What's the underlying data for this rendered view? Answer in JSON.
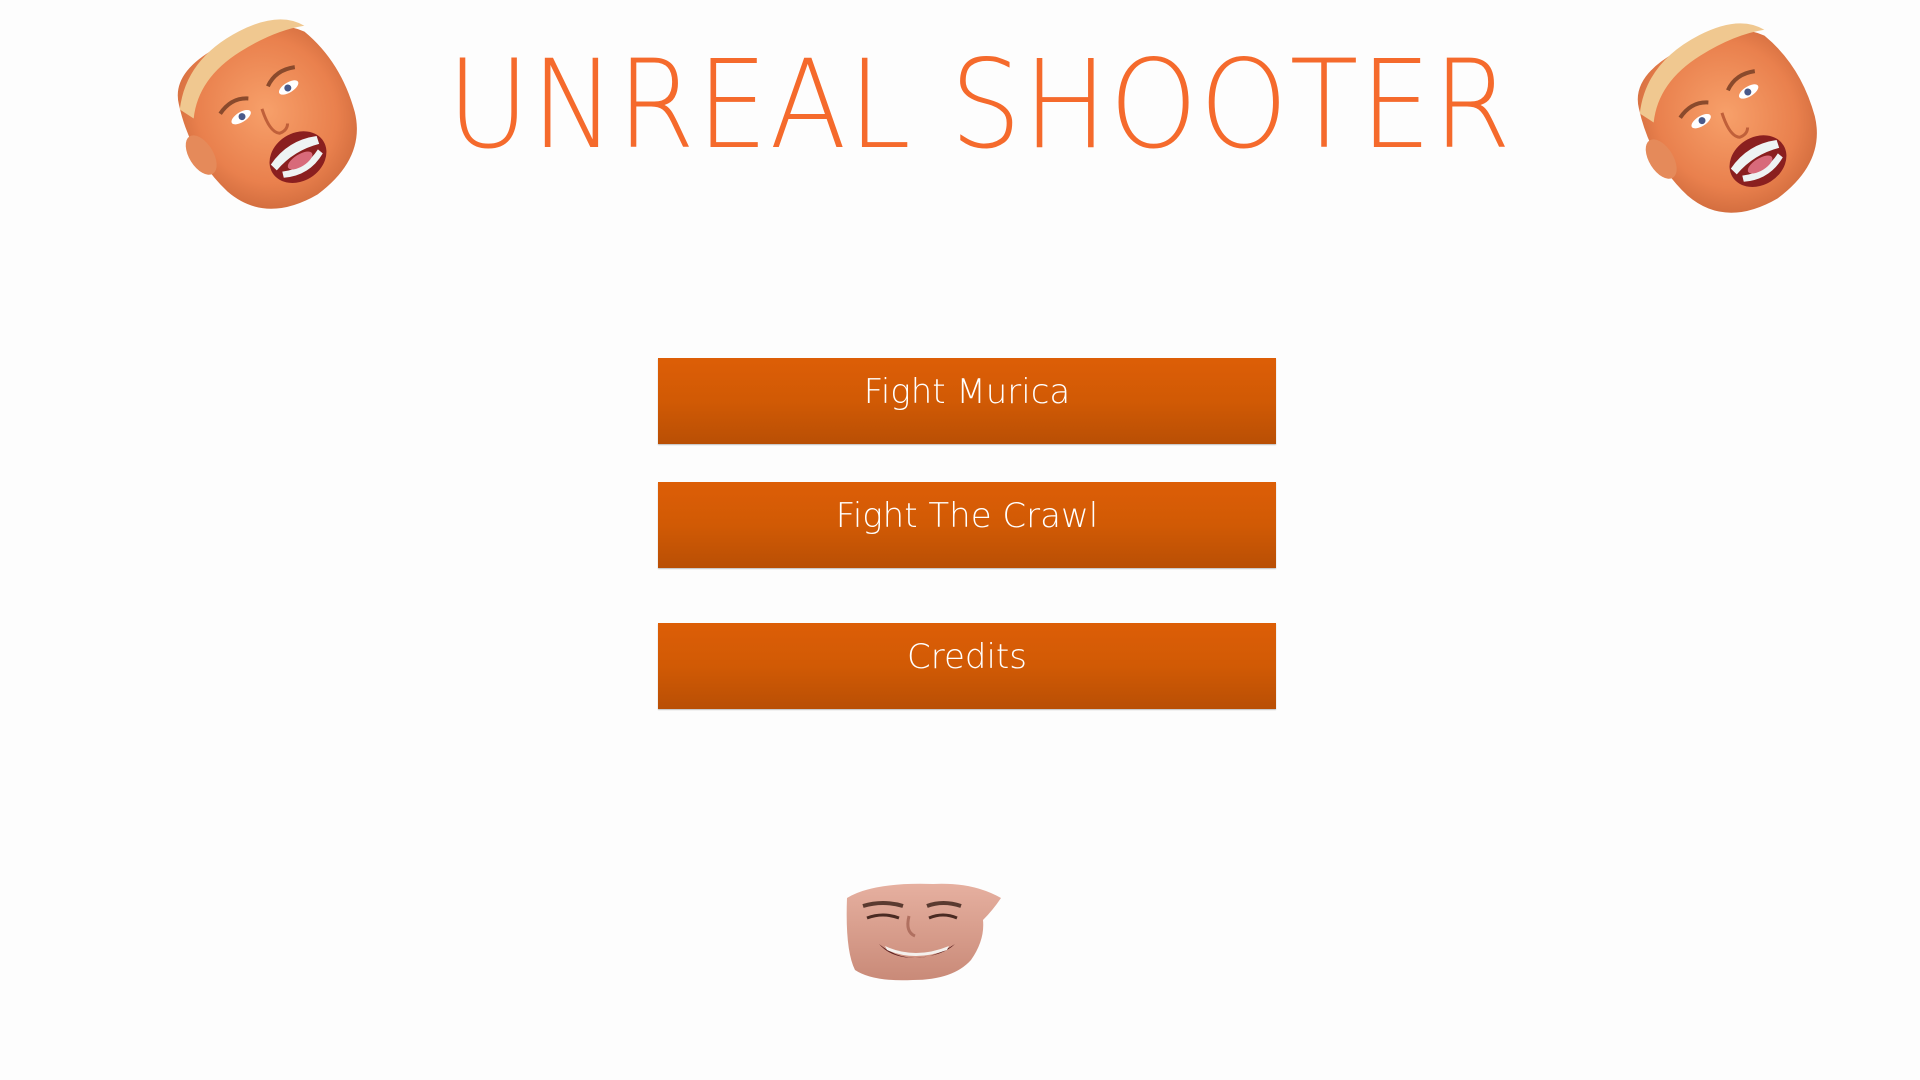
{
  "game": {
    "title": "UNREAL SHOOTER"
  },
  "menu": {
    "buttons": [
      {
        "label": "Fight Murica"
      },
      {
        "label": "Fight The Crawl"
      },
      {
        "label": "Credits"
      }
    ]
  },
  "decorations": {
    "left_face": "shouting-face-icon",
    "right_face": "shouting-face-icon",
    "bottom_face": "laughing-face-icon"
  },
  "colors": {
    "title": "#f56a2c",
    "button_top": "#dd5e06",
    "button_bottom": "#b94f05",
    "button_text": "#ffffff",
    "background": "#fdfdfd"
  }
}
